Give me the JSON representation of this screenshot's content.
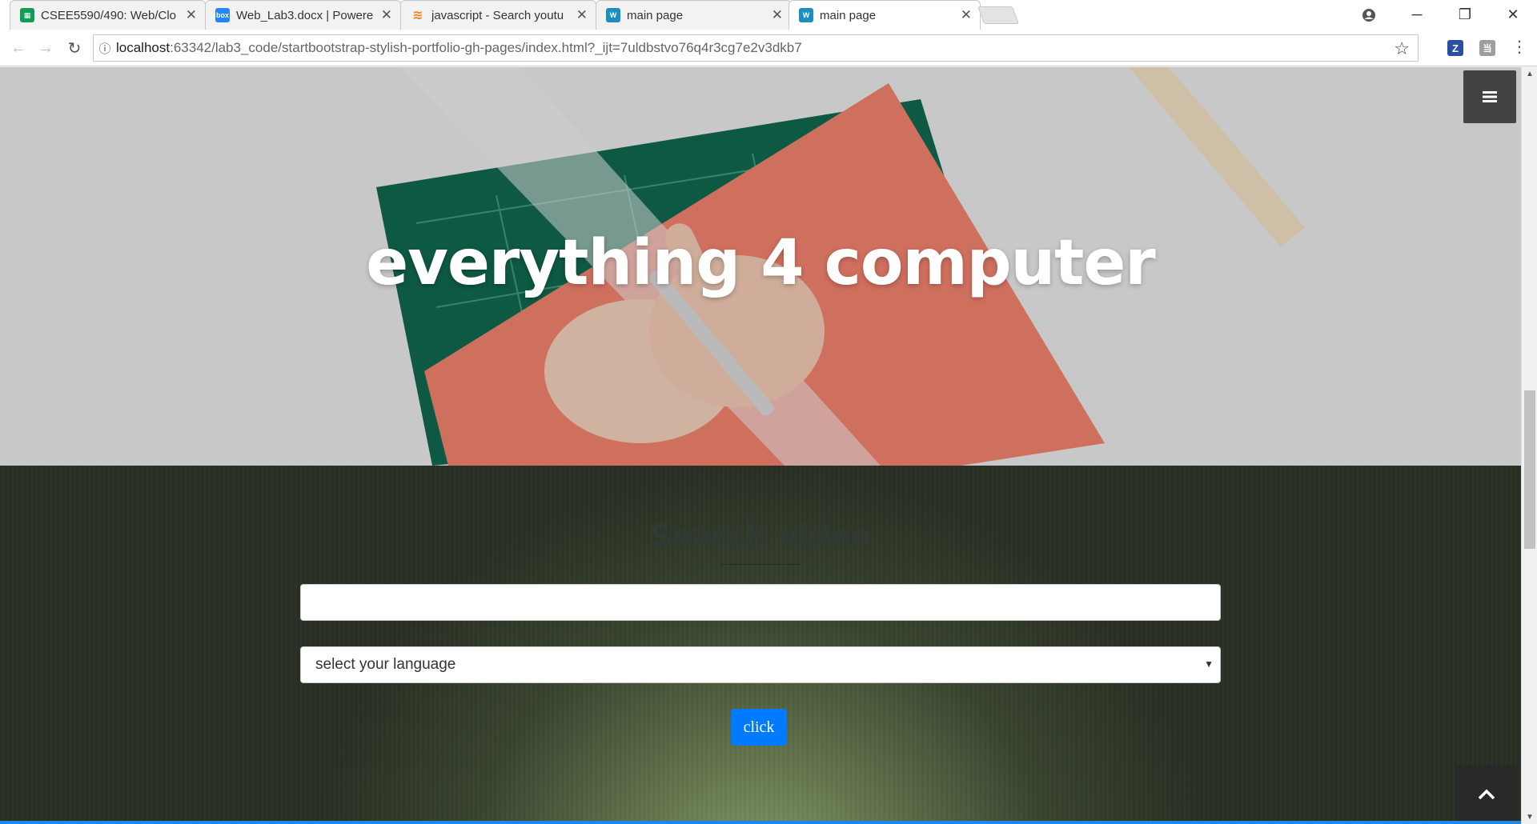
{
  "browser": {
    "tabs": [
      {
        "title": "CSEE5590/490: Web/Clo",
        "favicon": "sheets-icon",
        "color": "#0f9d58"
      },
      {
        "title": "Web_Lab3.docx | Powere",
        "favicon": "box-icon",
        "color": "#2486fc"
      },
      {
        "title": "javascript - Search youtu",
        "favicon": "stackoverflow-icon",
        "color": "#f48024"
      },
      {
        "title": "main page",
        "favicon": "webstorm-icon",
        "color": "#1a8fbf"
      },
      {
        "title": "main page",
        "favicon": "webstorm-icon",
        "color": "#1a8fbf"
      }
    ],
    "url_host": "localhost",
    "url_path": ":63342/lab3_code/startbootstrap-stylish-portfolio-gh-pages/index.html?_ijt=7uldbstvo76q4r3cg7e2v3dkb7",
    "extensions": [
      "Z",
      "当"
    ]
  },
  "hero": {
    "title": "everything 4 computer"
  },
  "search": {
    "heading": "Search video",
    "input_value": "",
    "language_select": "select your language",
    "button_label": "click"
  },
  "colors": {
    "button_primary": "#007bff",
    "hero_text": "#ffffff"
  }
}
